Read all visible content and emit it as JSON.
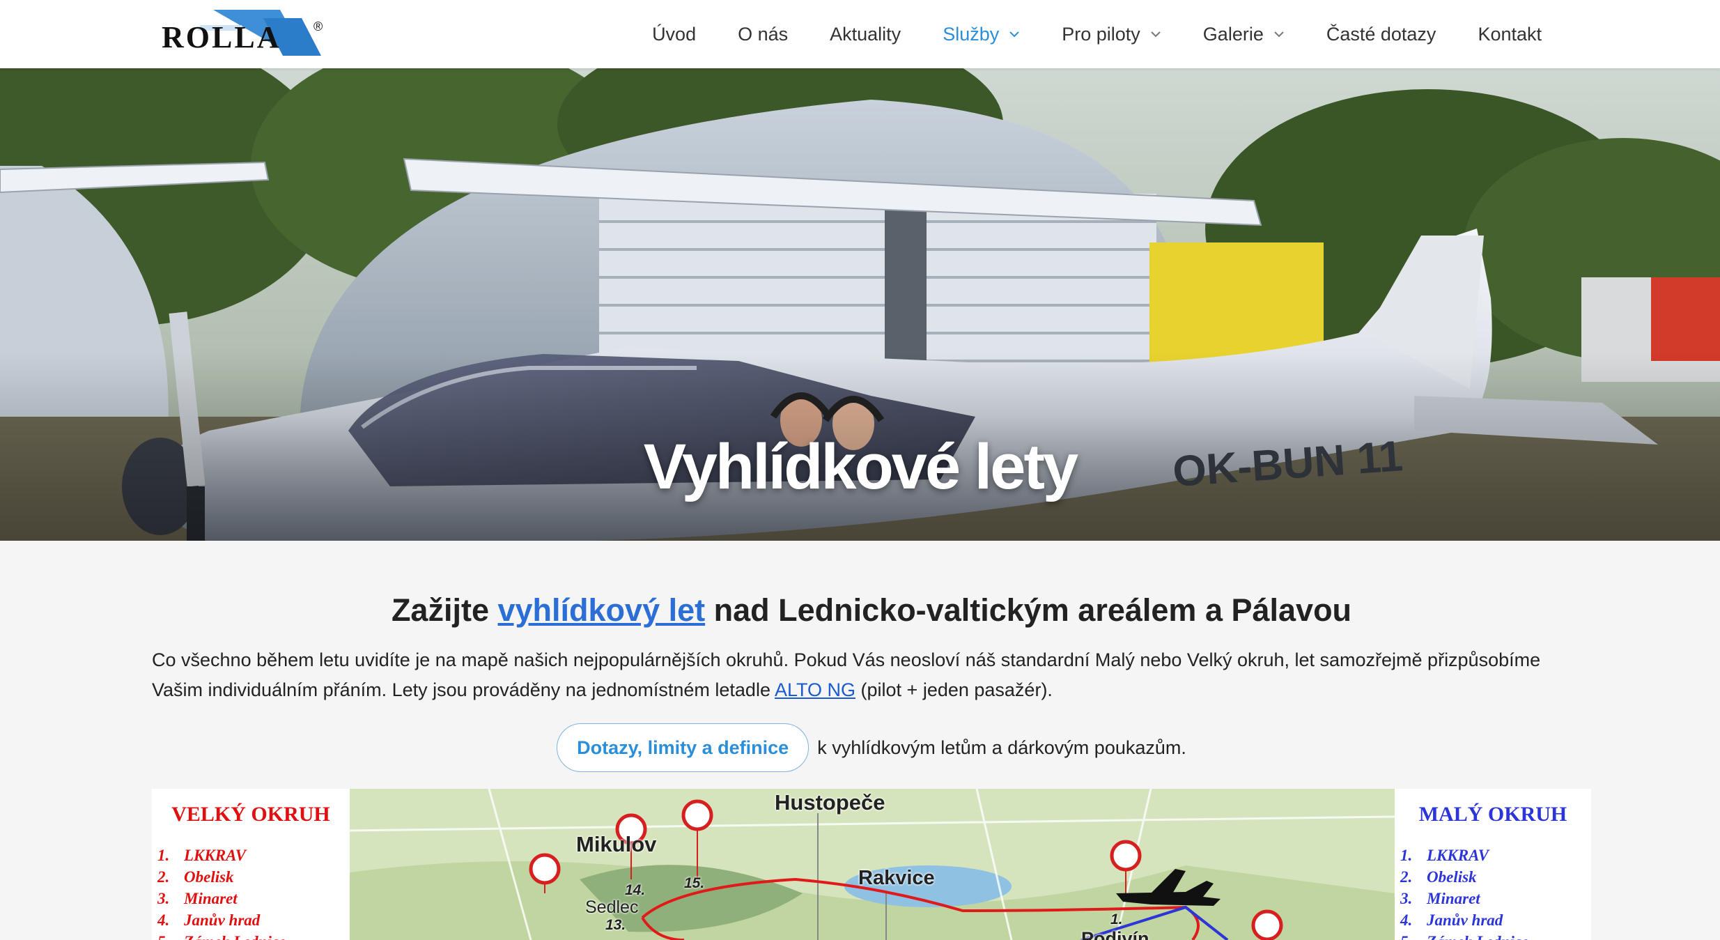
{
  "header": {
    "logo_text": "ROLLA",
    "logo_mark": "®",
    "nav": [
      {
        "label": "Úvod",
        "has_dropdown": false,
        "active": false
      },
      {
        "label": "O nás",
        "has_dropdown": false,
        "active": false
      },
      {
        "label": "Aktuality",
        "has_dropdown": false,
        "active": false
      },
      {
        "label": "Služby",
        "has_dropdown": true,
        "active": true
      },
      {
        "label": "Pro piloty",
        "has_dropdown": true,
        "active": false
      },
      {
        "label": "Galerie",
        "has_dropdown": true,
        "active": false
      },
      {
        "label": "Časté dotazy",
        "has_dropdown": false,
        "active": false
      },
      {
        "label": "Kontakt",
        "has_dropdown": false,
        "active": false
      }
    ]
  },
  "hero": {
    "title": "Vyhlídkové lety",
    "aircraft_registration": "OK-BUN 11"
  },
  "main": {
    "headline_prefix": "Zažijte",
    "headline_link": "vyhlídkový let",
    "headline_suffix": "nad Lednicko-valtickým areálem a Pálavou",
    "paragraph_part1": "Co všechno během letu uvidíte je na mapě našich nejpopulárnějších okruhů. Pokud Vás neosloví náš standardní Malý nebo Velký okruh, let samozřejmě přizpůsobíme Vašim individuálním přáním. Lety jsou prováděny na jednomístném letadle",
    "paragraph_link": "ALTO NG",
    "paragraph_part2": "(pilot + jeden pasažér).",
    "cta_button": "Dotazy, limity a definice",
    "cta_suffix": "k vyhlídkovým letům a dárkovým poukazům."
  },
  "map": {
    "big_route": {
      "title": "VELKÝ OKRUH",
      "items": [
        {
          "num": "1.",
          "label": "LKKRAV"
        },
        {
          "num": "2.",
          "label": "Obelisk"
        },
        {
          "num": "3.",
          "label": "Minaret"
        },
        {
          "num": "4.",
          "label": "Janův hrad"
        },
        {
          "num": "5.",
          "label": "Zámek Lednice"
        }
      ]
    },
    "small_route": {
      "title": "MALÝ OKRUH",
      "items": [
        {
          "num": "1.",
          "label": "LKKRAV"
        },
        {
          "num": "2.",
          "label": "Obelisk"
        },
        {
          "num": "3.",
          "label": "Minaret"
        },
        {
          "num": "4.",
          "label": "Janův hrad"
        },
        {
          "num": "5.",
          "label": "Zámek Lednice"
        }
      ]
    },
    "towns": [
      "Hustopeče",
      "Mikulov",
      "Rakvice",
      "Sedlec",
      "Podivín"
    ],
    "waypoint_numbers": [
      "14.",
      "15.",
      "13.",
      "1."
    ],
    "colors": {
      "big_route": "#e01a1a",
      "small_route": "#2b35d8",
      "pin": "#d62020"
    }
  }
}
